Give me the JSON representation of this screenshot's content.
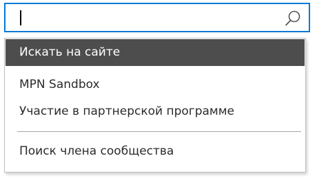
{
  "search": {
    "value": "",
    "placeholder": "",
    "icon": "search-icon"
  },
  "suggestions": {
    "items": [
      {
        "label": "Искать на сайте",
        "selected": true
      },
      {
        "label": "MPN Sandbox",
        "selected": false
      },
      {
        "label": "Участие в партнерской программе",
        "selected": false
      },
      {
        "label": "Поиск члена сообщества",
        "selected": false
      }
    ]
  },
  "colors": {
    "focus_border": "#0078d7",
    "selected_bg": "#4d4d4d",
    "selected_text": "#ffffff",
    "text": "#2b2b2b"
  }
}
